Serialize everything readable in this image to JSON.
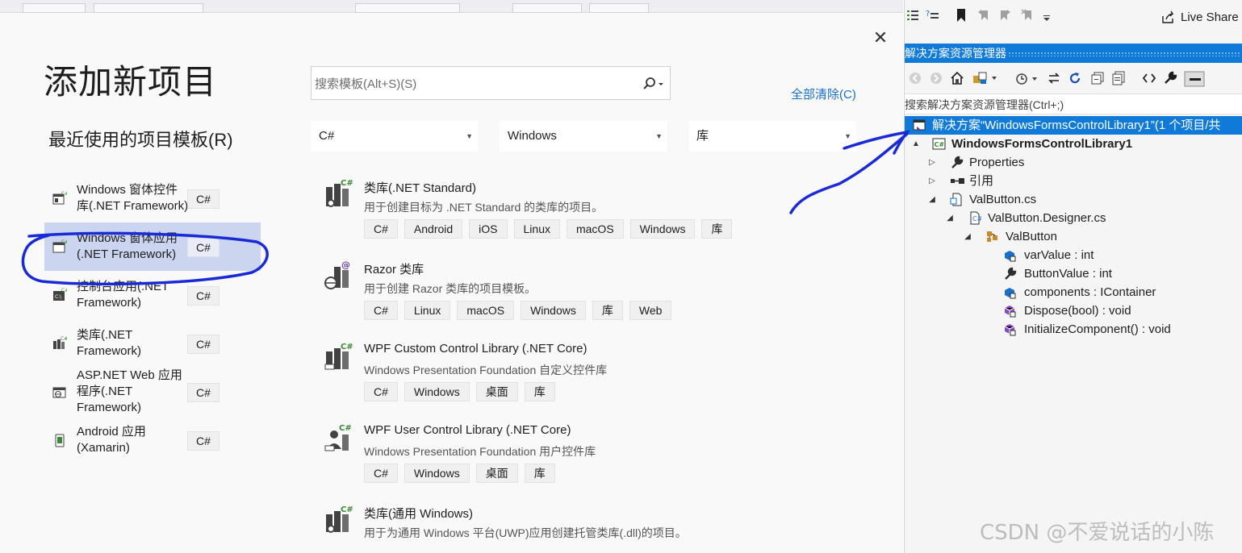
{
  "dialog": {
    "title": "添加新项目",
    "recent_title": "最近使用的项目模板(R)",
    "search_placeholder": "搜索模板(Alt+S)(S)",
    "clear_all": "全部清除(C)",
    "filters": {
      "language": "C#",
      "platform": "Windows",
      "project_type": "库"
    },
    "recent_items": [
      {
        "label": "Windows 窗体控件库(.NET Framework)",
        "lang": "C#",
        "icon": "control-library-icon"
      },
      {
        "label": "Windows 窗体应用(.NET Framework)",
        "lang": "C#",
        "icon": "winforms-app-icon",
        "selected": true
      },
      {
        "label": "控制台应用(.NET Framework)",
        "lang": "C#",
        "icon": "console-app-icon"
      },
      {
        "label": "类库(.NET Framework)",
        "lang": "C#",
        "icon": "class-library-icon"
      },
      {
        "label": "ASP.NET Web 应用程序(.NET Framework)",
        "lang": "C#",
        "icon": "web-app-icon"
      },
      {
        "label": "Android 应用(Xamarin)",
        "lang": "C#",
        "icon": "android-app-icon"
      }
    ],
    "templates": [
      {
        "name": "类库(.NET Standard)",
        "desc": "用于创建目标为 .NET Standard 的类库的项目。",
        "tags": [
          "C#",
          "Android",
          "iOS",
          "Linux",
          "macOS",
          "Windows",
          "库"
        ]
      },
      {
        "name": "Razor 类库",
        "desc": "用于创建 Razor 类库的项目模板。",
        "tags": [
          "C#",
          "Linux",
          "macOS",
          "Windows",
          "库",
          "Web"
        ]
      },
      {
        "name": "WPF Custom Control Library (.NET Core)",
        "desc": "Windows Presentation Foundation 自定义控件库",
        "tags": [
          "C#",
          "Windows",
          "桌面",
          "库"
        ]
      },
      {
        "name": "WPF User Control Library (.NET Core)",
        "desc": "Windows Presentation Foundation 用户控件库",
        "tags": [
          "C#",
          "Windows",
          "桌面",
          "库"
        ]
      },
      {
        "name": "类库(通用 Windows)",
        "desc": "用于为通用 Windows 平台(UWP)应用创建托管类库(.dll)的项目。",
        "tags": []
      }
    ]
  },
  "solution_explorer": {
    "live_share": "Live Share",
    "title": "解决方案资源管理器",
    "search_placeholder": "搜索解决方案资源管理器(Ctrl+;)",
    "tree": [
      {
        "label": "解决方案“WindowsFormsControlLibrary1”(1 个项目/共",
        "icon": "solution-icon",
        "depth": 0,
        "arrow": "",
        "selected": true
      },
      {
        "label": "WindowsFormsControlLibrary1",
        "icon": "csharp-project-icon",
        "depth": 1,
        "arrow": "▲",
        "bold": true
      },
      {
        "label": "Properties",
        "icon": "wrench-icon",
        "depth": 2,
        "arrow": "▷"
      },
      {
        "label": "引用",
        "icon": "references-icon",
        "depth": 2,
        "arrow": "▷"
      },
      {
        "label": "ValButton.cs",
        "icon": "cs-file-icon",
        "depth": 2,
        "arrow": "◢"
      },
      {
        "label": "ValButton.Designer.cs",
        "icon": "designer-file-icon",
        "depth": 3,
        "arrow": "◢"
      },
      {
        "label": "ValButton",
        "icon": "class-icon",
        "depth": 4,
        "arrow": "◢"
      },
      {
        "label": "varValue : int",
        "icon": "field-icon",
        "depth": 5,
        "arrow": ""
      },
      {
        "label": "ButtonValue : int",
        "icon": "property-icon",
        "depth": 5,
        "arrow": ""
      },
      {
        "label": "components : IContainer",
        "icon": "field-icon",
        "depth": 5,
        "arrow": ""
      },
      {
        "label": "Dispose(bool) : void",
        "icon": "method-icon",
        "depth": 5,
        "arrow": ""
      },
      {
        "label": "InitializeComponent() : void",
        "icon": "method-icon",
        "depth": 5,
        "arrow": ""
      }
    ]
  },
  "watermark": "CSDN @不爱说话的小陈",
  "colors": {
    "accent": "#0f7ad8",
    "link": "#1a6fc9",
    "selection": "#ccd5f0",
    "ink": "#1a2bd6"
  }
}
